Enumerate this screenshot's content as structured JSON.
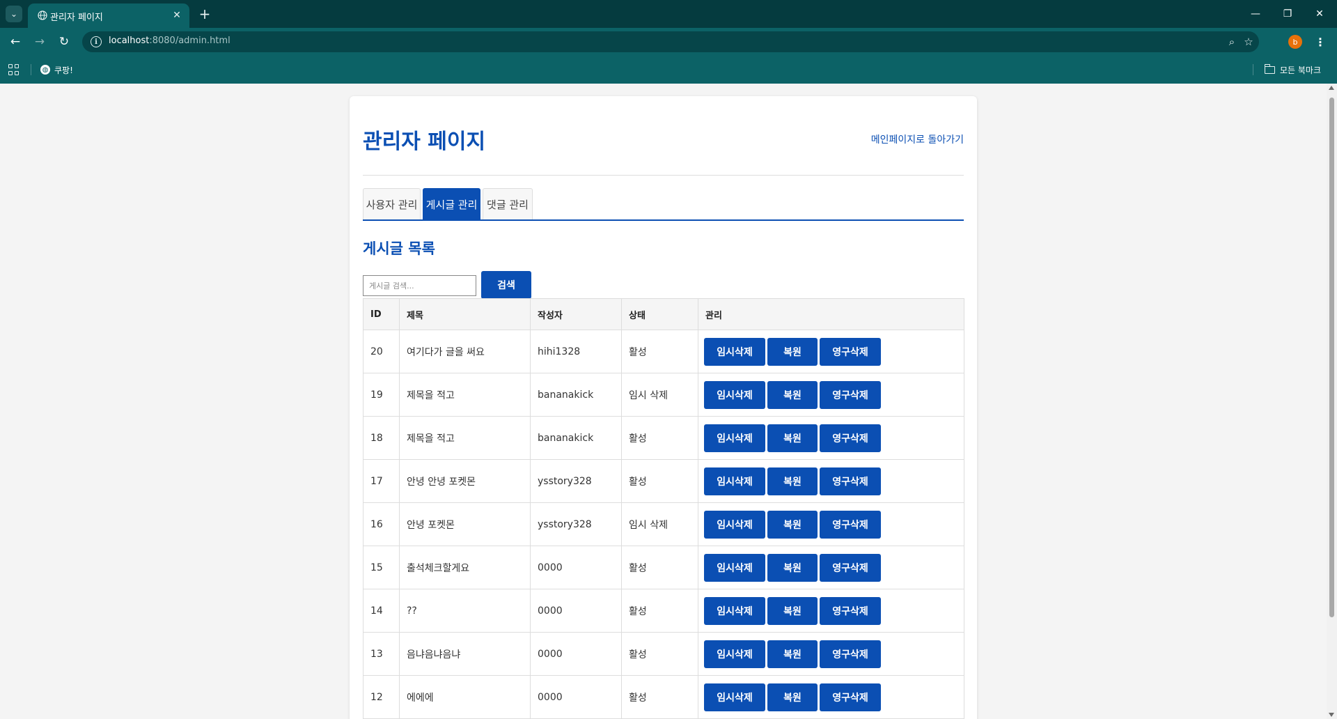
{
  "browser": {
    "tab_title": "관리자 페이지",
    "tab_close_icon": "close-icon",
    "new_tab_icon": "plus-icon",
    "url_host": "localhost",
    "url_rest": ":8080/admin.html",
    "profile_initial": "b",
    "bookmark_item": "쿠팡!",
    "bookmarks_folder": "모든 북마크"
  },
  "page": {
    "title": "관리자 페이지",
    "back_link": "메인페이지로 돌아가기",
    "tabs": [
      {
        "label": "사용자 관리",
        "active": false
      },
      {
        "label": "게시글 관리",
        "active": true
      },
      {
        "label": "댓글 관리",
        "active": false
      }
    ],
    "section_title": "게시글 목록",
    "search": {
      "placeholder": "게시글 검색...",
      "value": "",
      "button": "검색"
    },
    "table": {
      "headers": [
        "ID",
        "제목",
        "작성자",
        "상태",
        "관리"
      ],
      "action_labels": {
        "soft_delete": "임시삭제",
        "restore": "복원",
        "hard_delete": "영구삭제"
      },
      "rows": [
        {
          "id": "20",
          "title": "여기다가 글을 써요",
          "author": "hihi1328",
          "status": "활성"
        },
        {
          "id": "19",
          "title": "제목을 적고",
          "author": "bananakick",
          "status": "임시 삭제"
        },
        {
          "id": "18",
          "title": "제목을 적고",
          "author": "bananakick",
          "status": "활성"
        },
        {
          "id": "17",
          "title": "안녕 안녕 포켓몬",
          "author": "ysstory328",
          "status": "활성"
        },
        {
          "id": "16",
          "title": "안녕 포켓몬",
          "author": "ysstory328",
          "status": "임시 삭제"
        },
        {
          "id": "15",
          "title": "출석체크할게요",
          "author": "0000",
          "status": "활성"
        },
        {
          "id": "14",
          "title": "??",
          "author": "0000",
          "status": "활성"
        },
        {
          "id": "13",
          "title": "음냐음냐음냐",
          "author": "0000",
          "status": "활성"
        },
        {
          "id": "12",
          "title": "에에에",
          "author": "0000",
          "status": "활성"
        }
      ]
    }
  },
  "colors": {
    "accent": "#0b4fb3",
    "chrome_dark": "#053b3f",
    "chrome": "#0c6266"
  }
}
